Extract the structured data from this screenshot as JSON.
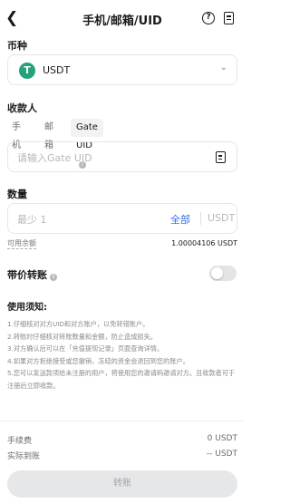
{
  "header": {
    "back_icon": "back-arrow-icon",
    "title": "手机/邮箱/UID",
    "help_icon": "help-icon",
    "record_icon": "record-icon"
  },
  "currency": {
    "label": "币种",
    "selected": "USDT",
    "coin_icon_text": "T",
    "coin_color": "#26a17b"
  },
  "recipient": {
    "label": "收款人",
    "tabs": [
      {
        "label": "手机"
      },
      {
        "label": "邮箱"
      },
      {
        "label": "Gate UID"
      }
    ],
    "active_tab": 2,
    "placeholder": "请输入Gate UID"
  },
  "amount": {
    "label": "数量",
    "placeholder": "最少 1",
    "all_label": "全部",
    "unit": "USDT",
    "available_label": "可用余额",
    "available_value": "1.00004106 USDT"
  },
  "memo": {
    "label": "带价转账",
    "enabled": false
  },
  "notice": {
    "title": "使用须知:",
    "items": [
      "1.仔细核对对方UID和对方账户，以免转错账户。",
      "2.转账时仔细核对转账数量和金额，防止造成损失。",
      "3.对方确认后可以在「充值提现记录」页面查询详情。",
      "4.如果对方拒绝接受或您撤销，冻结的资金会退回到您的账户。",
      "5.您可以发送款项给未注册的用户，将使用您的邀请码邀请对方。且收款者可于注册后立即收款。"
    ]
  },
  "footer": {
    "fee_label": "手续费",
    "fee_value": "0 USDT",
    "received_label": "实际到账",
    "received_value": "-- USDT",
    "submit_label": "转账"
  },
  "colors": {
    "accent": "#2f6fec",
    "border": "#e6e6e6",
    "disabled_button": "#e6e7e9"
  }
}
